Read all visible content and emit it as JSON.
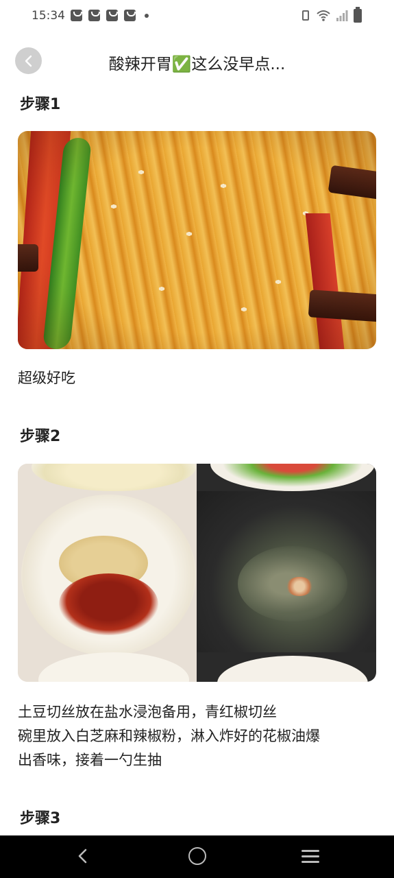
{
  "status_bar": {
    "time": "15:34",
    "notification_icons": [
      "bag-icon",
      "bag-icon",
      "bag-icon",
      "bag-icon"
    ],
    "right_icons": [
      "vibrate-icon",
      "wifi-icon",
      "signal-icon",
      "battery-icon"
    ]
  },
  "header": {
    "title": "酸辣开胃✅这么没早点..."
  },
  "steps": [
    {
      "title": "步骤1",
      "image_alt": "酸辣土豆丝",
      "lines": [
        "超级好吃"
      ]
    },
    {
      "title": "步骤2",
      "image_alt": "拼图：碗里的白芝麻和辣椒粉、锅里的花椒油",
      "lines": [
        "土豆切丝放在盐水浸泡备用，青红椒切丝",
        "碗里放入白芝麻和辣椒粉，淋入炸好的花椒油爆",
        "出香味，接着一勺生抽"
      ]
    },
    {
      "title": "步骤3"
    }
  ],
  "nav_bar": {
    "buttons": [
      "back-nav-icon",
      "home-nav-icon",
      "menu-nav-icon"
    ]
  }
}
